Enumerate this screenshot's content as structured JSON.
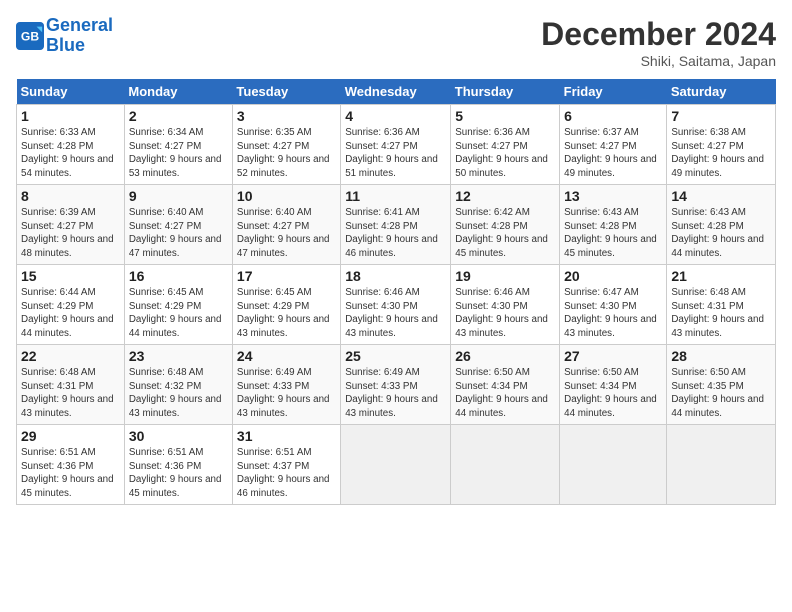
{
  "header": {
    "logo_line1": "General",
    "logo_line2": "Blue",
    "month_title": "December 2024",
    "location": "Shiki, Saitama, Japan"
  },
  "weekdays": [
    "Sunday",
    "Monday",
    "Tuesday",
    "Wednesday",
    "Thursday",
    "Friday",
    "Saturday"
  ],
  "weeks": [
    [
      {
        "day": "1",
        "sunrise": "Sunrise: 6:33 AM",
        "sunset": "Sunset: 4:28 PM",
        "daylight": "Daylight: 9 hours and 54 minutes."
      },
      {
        "day": "2",
        "sunrise": "Sunrise: 6:34 AM",
        "sunset": "Sunset: 4:27 PM",
        "daylight": "Daylight: 9 hours and 53 minutes."
      },
      {
        "day": "3",
        "sunrise": "Sunrise: 6:35 AM",
        "sunset": "Sunset: 4:27 PM",
        "daylight": "Daylight: 9 hours and 52 minutes."
      },
      {
        "day": "4",
        "sunrise": "Sunrise: 6:36 AM",
        "sunset": "Sunset: 4:27 PM",
        "daylight": "Daylight: 9 hours and 51 minutes."
      },
      {
        "day": "5",
        "sunrise": "Sunrise: 6:36 AM",
        "sunset": "Sunset: 4:27 PM",
        "daylight": "Daylight: 9 hours and 50 minutes."
      },
      {
        "day": "6",
        "sunrise": "Sunrise: 6:37 AM",
        "sunset": "Sunset: 4:27 PM",
        "daylight": "Daylight: 9 hours and 49 minutes."
      },
      {
        "day": "7",
        "sunrise": "Sunrise: 6:38 AM",
        "sunset": "Sunset: 4:27 PM",
        "daylight": "Daylight: 9 hours and 49 minutes."
      }
    ],
    [
      {
        "day": "8",
        "sunrise": "Sunrise: 6:39 AM",
        "sunset": "Sunset: 4:27 PM",
        "daylight": "Daylight: 9 hours and 48 minutes."
      },
      {
        "day": "9",
        "sunrise": "Sunrise: 6:40 AM",
        "sunset": "Sunset: 4:27 PM",
        "daylight": "Daylight: 9 hours and 47 minutes."
      },
      {
        "day": "10",
        "sunrise": "Sunrise: 6:40 AM",
        "sunset": "Sunset: 4:27 PM",
        "daylight": "Daylight: 9 hours and 47 minutes."
      },
      {
        "day": "11",
        "sunrise": "Sunrise: 6:41 AM",
        "sunset": "Sunset: 4:28 PM",
        "daylight": "Daylight: 9 hours and 46 minutes."
      },
      {
        "day": "12",
        "sunrise": "Sunrise: 6:42 AM",
        "sunset": "Sunset: 4:28 PM",
        "daylight": "Daylight: 9 hours and 45 minutes."
      },
      {
        "day": "13",
        "sunrise": "Sunrise: 6:43 AM",
        "sunset": "Sunset: 4:28 PM",
        "daylight": "Daylight: 9 hours and 45 minutes."
      },
      {
        "day": "14",
        "sunrise": "Sunrise: 6:43 AM",
        "sunset": "Sunset: 4:28 PM",
        "daylight": "Daylight: 9 hours and 44 minutes."
      }
    ],
    [
      {
        "day": "15",
        "sunrise": "Sunrise: 6:44 AM",
        "sunset": "Sunset: 4:29 PM",
        "daylight": "Daylight: 9 hours and 44 minutes."
      },
      {
        "day": "16",
        "sunrise": "Sunrise: 6:45 AM",
        "sunset": "Sunset: 4:29 PM",
        "daylight": "Daylight: 9 hours and 44 minutes."
      },
      {
        "day": "17",
        "sunrise": "Sunrise: 6:45 AM",
        "sunset": "Sunset: 4:29 PM",
        "daylight": "Daylight: 9 hours and 43 minutes."
      },
      {
        "day": "18",
        "sunrise": "Sunrise: 6:46 AM",
        "sunset": "Sunset: 4:30 PM",
        "daylight": "Daylight: 9 hours and 43 minutes."
      },
      {
        "day": "19",
        "sunrise": "Sunrise: 6:46 AM",
        "sunset": "Sunset: 4:30 PM",
        "daylight": "Daylight: 9 hours and 43 minutes."
      },
      {
        "day": "20",
        "sunrise": "Sunrise: 6:47 AM",
        "sunset": "Sunset: 4:30 PM",
        "daylight": "Daylight: 9 hours and 43 minutes."
      },
      {
        "day": "21",
        "sunrise": "Sunrise: 6:48 AM",
        "sunset": "Sunset: 4:31 PM",
        "daylight": "Daylight: 9 hours and 43 minutes."
      }
    ],
    [
      {
        "day": "22",
        "sunrise": "Sunrise: 6:48 AM",
        "sunset": "Sunset: 4:31 PM",
        "daylight": "Daylight: 9 hours and 43 minutes."
      },
      {
        "day": "23",
        "sunrise": "Sunrise: 6:48 AM",
        "sunset": "Sunset: 4:32 PM",
        "daylight": "Daylight: 9 hours and 43 minutes."
      },
      {
        "day": "24",
        "sunrise": "Sunrise: 6:49 AM",
        "sunset": "Sunset: 4:33 PM",
        "daylight": "Daylight: 9 hours and 43 minutes."
      },
      {
        "day": "25",
        "sunrise": "Sunrise: 6:49 AM",
        "sunset": "Sunset: 4:33 PM",
        "daylight": "Daylight: 9 hours and 43 minutes."
      },
      {
        "day": "26",
        "sunrise": "Sunrise: 6:50 AM",
        "sunset": "Sunset: 4:34 PM",
        "daylight": "Daylight: 9 hours and 44 minutes."
      },
      {
        "day": "27",
        "sunrise": "Sunrise: 6:50 AM",
        "sunset": "Sunset: 4:34 PM",
        "daylight": "Daylight: 9 hours and 44 minutes."
      },
      {
        "day": "28",
        "sunrise": "Sunrise: 6:50 AM",
        "sunset": "Sunset: 4:35 PM",
        "daylight": "Daylight: 9 hours and 44 minutes."
      }
    ],
    [
      {
        "day": "29",
        "sunrise": "Sunrise: 6:51 AM",
        "sunset": "Sunset: 4:36 PM",
        "daylight": "Daylight: 9 hours and 45 minutes."
      },
      {
        "day": "30",
        "sunrise": "Sunrise: 6:51 AM",
        "sunset": "Sunset: 4:36 PM",
        "daylight": "Daylight: 9 hours and 45 minutes."
      },
      {
        "day": "31",
        "sunrise": "Sunrise: 6:51 AM",
        "sunset": "Sunset: 4:37 PM",
        "daylight": "Daylight: 9 hours and 46 minutes."
      },
      null,
      null,
      null,
      null
    ]
  ]
}
